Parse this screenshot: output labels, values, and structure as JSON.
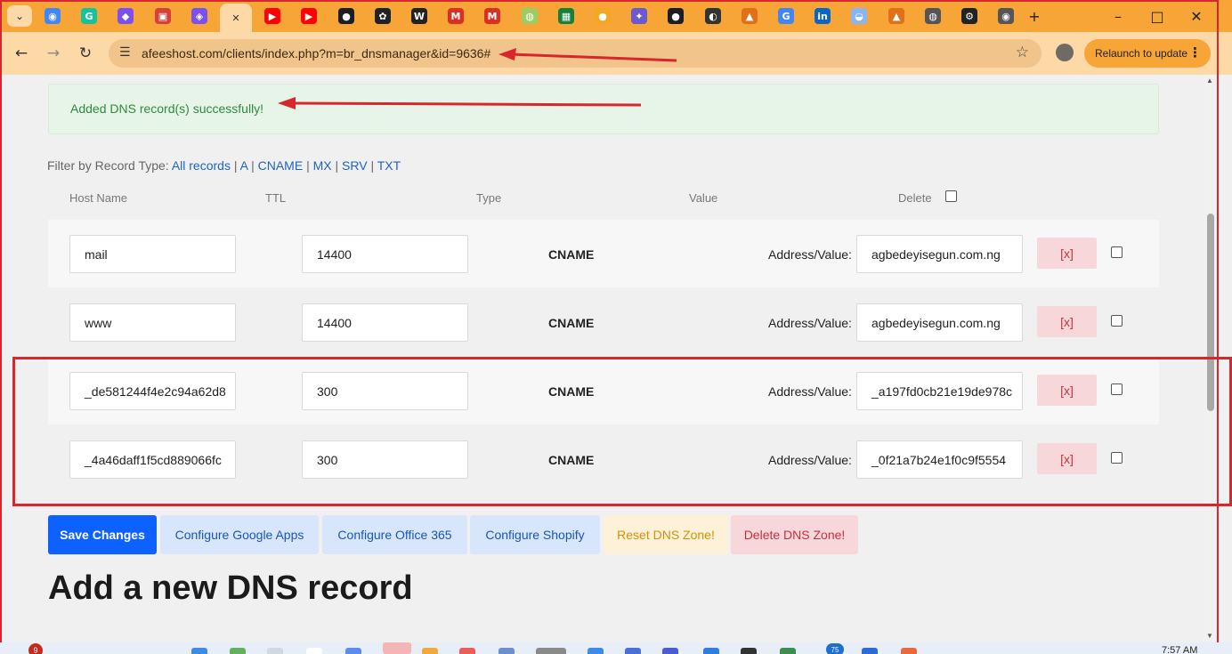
{
  "browser": {
    "url": "afeeshost.com/clients/index.php?m=br_dnsmanager&id=9636#",
    "relaunch_label": "Relaunch to update",
    "tabs": [
      {
        "icon": "chrome-icon",
        "color": "#4285f4"
      },
      {
        "icon": "grammarly-icon",
        "color": "#15c39a"
      },
      {
        "icon": "app-icon-purple",
        "color": "#7b4ff0"
      },
      {
        "icon": "app-icon-red",
        "color": "#d3413a"
      },
      {
        "icon": "app-icon-violet",
        "color": "#7b4ff0"
      },
      {
        "icon": "close-icon",
        "color": "#333333"
      },
      {
        "icon": "youtube-icon",
        "color": "#ff0000"
      },
      {
        "icon": "youtube-icon",
        "color": "#ff0000"
      },
      {
        "icon": "github-icon",
        "color": "#1b1f23"
      },
      {
        "icon": "openai-icon",
        "color": "#222222"
      },
      {
        "icon": "wikipedia-icon",
        "color": "#222222"
      },
      {
        "icon": "gmail-icon",
        "color": "#d93025"
      },
      {
        "icon": "gmail-icon",
        "color": "#d93025"
      },
      {
        "icon": "globe-icon",
        "color": "#9ccc65"
      },
      {
        "icon": "sheets-icon",
        "color": "#188038"
      },
      {
        "icon": "circle-icon",
        "color": "#f5a623"
      },
      {
        "icon": "bird-icon",
        "color": "#6a5acd"
      },
      {
        "icon": "github-icon",
        "color": "#1b1f23"
      },
      {
        "icon": "app-icon-dark",
        "color": "#333333"
      },
      {
        "icon": "fox-icon",
        "color": "#e0701a"
      },
      {
        "icon": "google-icon",
        "color": "#4285f4"
      },
      {
        "icon": "linkedin-icon",
        "color": "#0a66c2"
      },
      {
        "icon": "app-icon-blue",
        "color": "#8ab4f8"
      },
      {
        "icon": "fox-icon",
        "color": "#e0701a"
      },
      {
        "icon": "globe-icon",
        "color": "#555555"
      },
      {
        "icon": "gear-icon",
        "color": "#222222"
      },
      {
        "icon": "chrome-icon",
        "color": "#555555"
      }
    ]
  },
  "alert": {
    "text": "Added DNS record(s) successfully!"
  },
  "filter": {
    "label": "Filter by Record Type:",
    "options": [
      "All records",
      "A",
      "CNAME",
      "MX",
      "SRV",
      "TXT"
    ],
    "separator": "|"
  },
  "table": {
    "headers": {
      "host": "Host Name",
      "ttl": "TTL",
      "type": "Type",
      "value": "Value",
      "delete": "Delete"
    },
    "rows": [
      {
        "host": "mail",
        "ttl": "14400",
        "type": "CNAME",
        "value_label": "Address/Value:",
        "value": "agbedeyisegun.com.ng",
        "delete_label": "[x]"
      },
      {
        "host": "www",
        "ttl": "14400",
        "type": "CNAME",
        "value_label": "Address/Value:",
        "value": "agbedeyisegun.com.ng",
        "delete_label": "[x]"
      },
      {
        "host": "_de581244f4e2c94a62d8",
        "ttl": "300",
        "type": "CNAME",
        "value_label": "Address/Value:",
        "value": "_a197fd0cb21e19de978c",
        "delete_label": "[x]"
      },
      {
        "host": "_4a46daff1f5cd889066fc",
        "ttl": "300",
        "type": "CNAME",
        "value_label": "Address/Value:",
        "value": "_0f21a7b24e1f0c9f5554",
        "delete_label": "[x]"
      }
    ]
  },
  "actions": {
    "save": "Save Changes",
    "google": "Configure Google Apps",
    "office365": "Configure Office 365",
    "shopify": "Configure Shopify",
    "reset": "Reset DNS Zone!",
    "delete_zone": "Delete DNS Zone!"
  },
  "add_section": {
    "heading": "Add a new DNS record"
  },
  "taskbar": {
    "badge_count": "9",
    "badge_count_2": "75",
    "clock": "7:57 AM"
  },
  "colors": {
    "tab_strip": "#f7a536",
    "toolbar": "#fdd9a8",
    "annotation_red": "#d7262c",
    "primary_blue": "#0d62ff"
  }
}
